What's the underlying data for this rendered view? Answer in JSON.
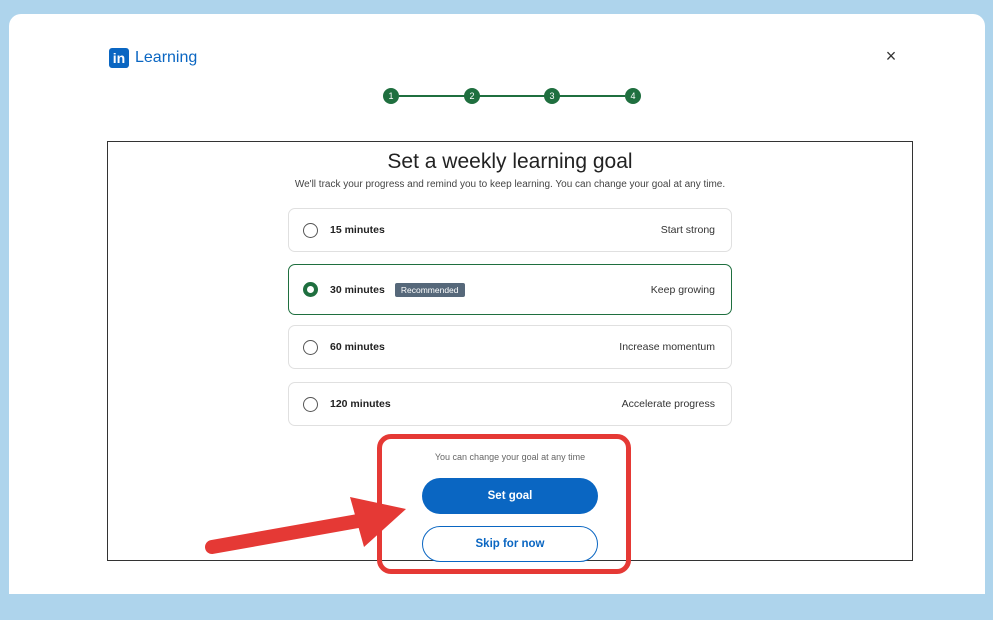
{
  "header": {
    "logo_mark": "in",
    "logo_text": "Learning",
    "close_symbol": "×",
    "icons": {
      "close": "close-icon"
    }
  },
  "stepper": {
    "steps": [
      "1",
      "2",
      "3",
      "4"
    ],
    "active_color": "#1f6f3f"
  },
  "goal": {
    "title": "Set a weekly learning goal",
    "subtitle": "We'll track your progress and remind you to keep learning. You can change your goal at any time.",
    "options": [
      {
        "label": "15 minutes",
        "right": "Start strong",
        "selected": false,
        "badge": ""
      },
      {
        "label": "30 minutes",
        "right": "Keep growing",
        "selected": true,
        "badge": "Recommended"
      },
      {
        "label": "60 minutes",
        "right": "Increase momentum",
        "selected": false,
        "badge": ""
      },
      {
        "label": "120 minutes",
        "right": "Accelerate progress",
        "selected": false,
        "badge": ""
      }
    ],
    "hint": "You can change your goal at any time",
    "primary_label": "Set goal",
    "secondary_label": "Skip for now"
  },
  "colors": {
    "brand": "#0a66c2",
    "highlight": "#e53935",
    "background": "#aed4ec"
  }
}
